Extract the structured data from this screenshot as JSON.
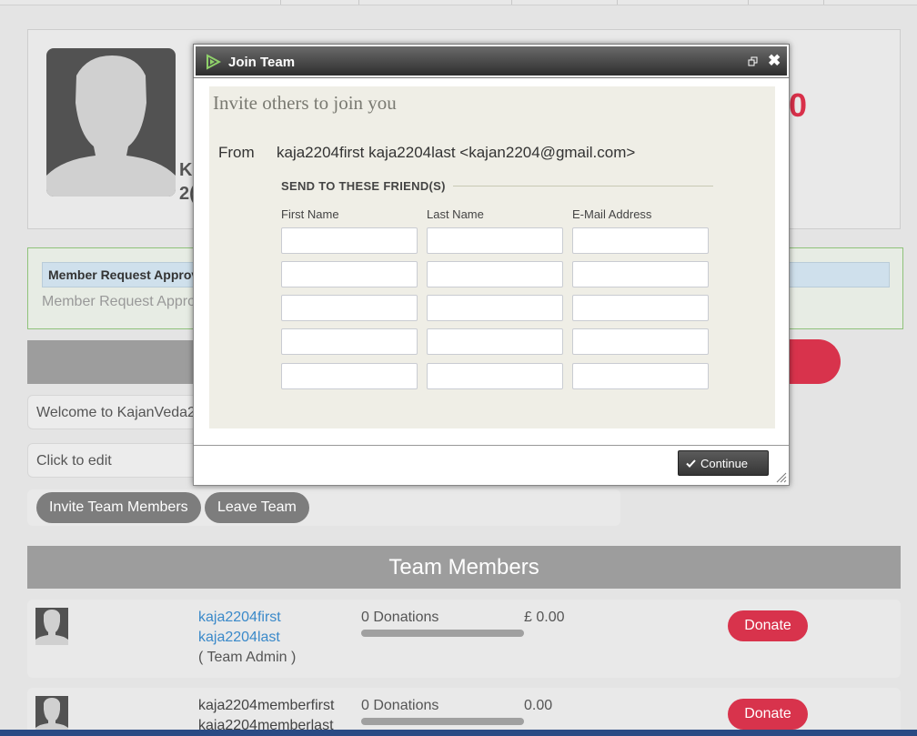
{
  "profile": {
    "name_fragment_1": "K",
    "name_fragment_2": "2(",
    "amount_fragment": "0"
  },
  "approval": {
    "header": "Member Request Approv",
    "text": "Member Request Appro"
  },
  "welcome_text": "Welcome to KajanVeda2",
  "edit_text": "Click to edit",
  "buttons": {
    "invite": "Invite Team Members",
    "leave": "Leave Team"
  },
  "team_header": "Team Members",
  "members": [
    {
      "first": "kaja2204first",
      "last": "kaja2204last",
      "role": "( Team Admin )",
      "donations": "0 Donations",
      "amount": "£ 0.00",
      "donate": "Donate"
    },
    {
      "first": "kaja2204memberfirst",
      "last": "kaja2204memberlast",
      "role": "",
      "donations": "0 Donations",
      "amount": "0.00",
      "donate": "Donate"
    }
  ],
  "modal": {
    "title": "Join Team",
    "heading": "Invite others to join you",
    "from_label": "From",
    "from_value": "kaja2204first kaja2204last <kajan2204@gmail.com>",
    "send_legend": "SEND TO THESE FRIEND(S)",
    "columns": [
      "First Name",
      "Last Name",
      "E-Mail Address"
    ],
    "continue_label": "Continue",
    "close_symbol": "✖"
  },
  "colors": {
    "accent_red": "#d8334c",
    "link_blue": "#3a89c9",
    "header_grey": "#9d9d9d"
  }
}
